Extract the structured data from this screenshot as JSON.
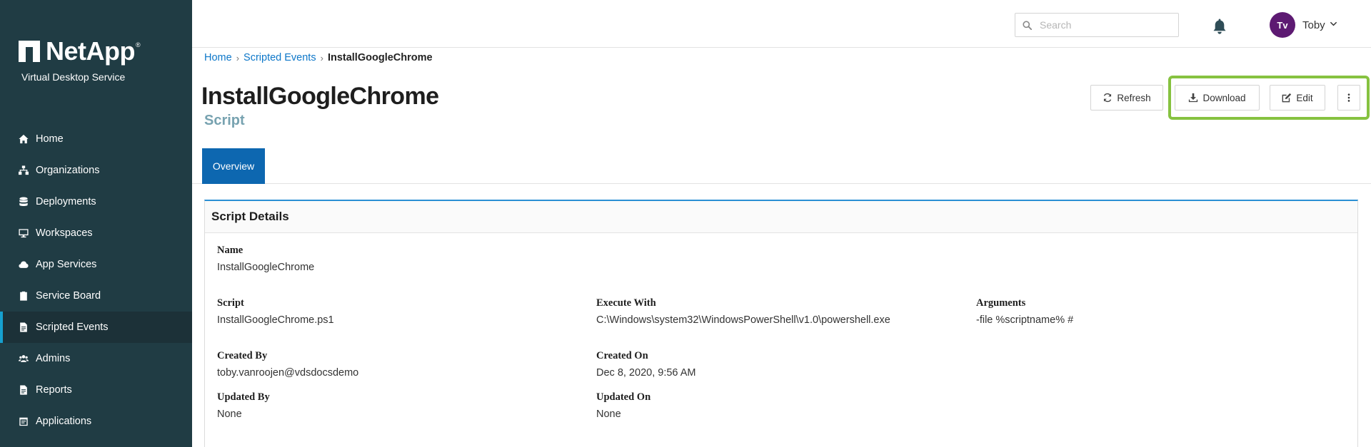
{
  "brand": {
    "name": "NetApp",
    "product": "Virtual Desktop Service"
  },
  "sidebar": {
    "items": [
      {
        "label": "Home",
        "icon": "home-icon"
      },
      {
        "label": "Organizations",
        "icon": "sitemap-icon"
      },
      {
        "label": "Deployments",
        "icon": "database-icon"
      },
      {
        "label": "Workspaces",
        "icon": "desktop-icon"
      },
      {
        "label": "App Services",
        "icon": "cloud-icon"
      },
      {
        "label": "Service Board",
        "icon": "clipboard-icon"
      },
      {
        "label": "Scripted Events",
        "icon": "file-script-icon",
        "active": true
      },
      {
        "label": "Admins",
        "icon": "users-icon"
      },
      {
        "label": "Reports",
        "icon": "file-report-icon"
      },
      {
        "label": "Applications",
        "icon": "apps-icon"
      }
    ]
  },
  "header": {
    "search_placeholder": "Search",
    "user": {
      "initials": "Tv",
      "name": "Toby",
      "avatar_color": "#5d1a72"
    }
  },
  "breadcrumb": {
    "items": [
      "Home",
      "Scripted Events"
    ],
    "current": "InstallGoogleChrome"
  },
  "page": {
    "title": "InstallGoogleChrome",
    "subtitle": "Script"
  },
  "actions": {
    "refresh": "Refresh",
    "download": "Download",
    "edit": "Edit"
  },
  "tabs": [
    {
      "label": "Overview",
      "active": true
    }
  ],
  "details": {
    "title": "Script Details",
    "name": {
      "label": "Name",
      "value": "InstallGoogleChrome"
    },
    "script": {
      "label": "Script",
      "value": "InstallGoogleChrome.ps1"
    },
    "execute_with": {
      "label": "Execute With",
      "value": "C:\\Windows\\system32\\WindowsPowerShell\\v1.0\\powershell.exe"
    },
    "arguments": {
      "label": "Arguments",
      "value": "-file %scriptname% #"
    },
    "created_by": {
      "label": "Created By",
      "value": "toby.vanroojen@vdsdocsdemo"
    },
    "created_on": {
      "label": "Created On",
      "value": "Dec 8, 2020, 9:56 AM"
    },
    "updated_by": {
      "label": "Updated By",
      "value": "None"
    },
    "updated_on": {
      "label": "Updated On",
      "value": "None"
    }
  },
  "colors": {
    "sidebar_bg": "#203c44",
    "accent": "#0d67b0",
    "link": "#0d77c9",
    "highlight": "#86c240"
  }
}
